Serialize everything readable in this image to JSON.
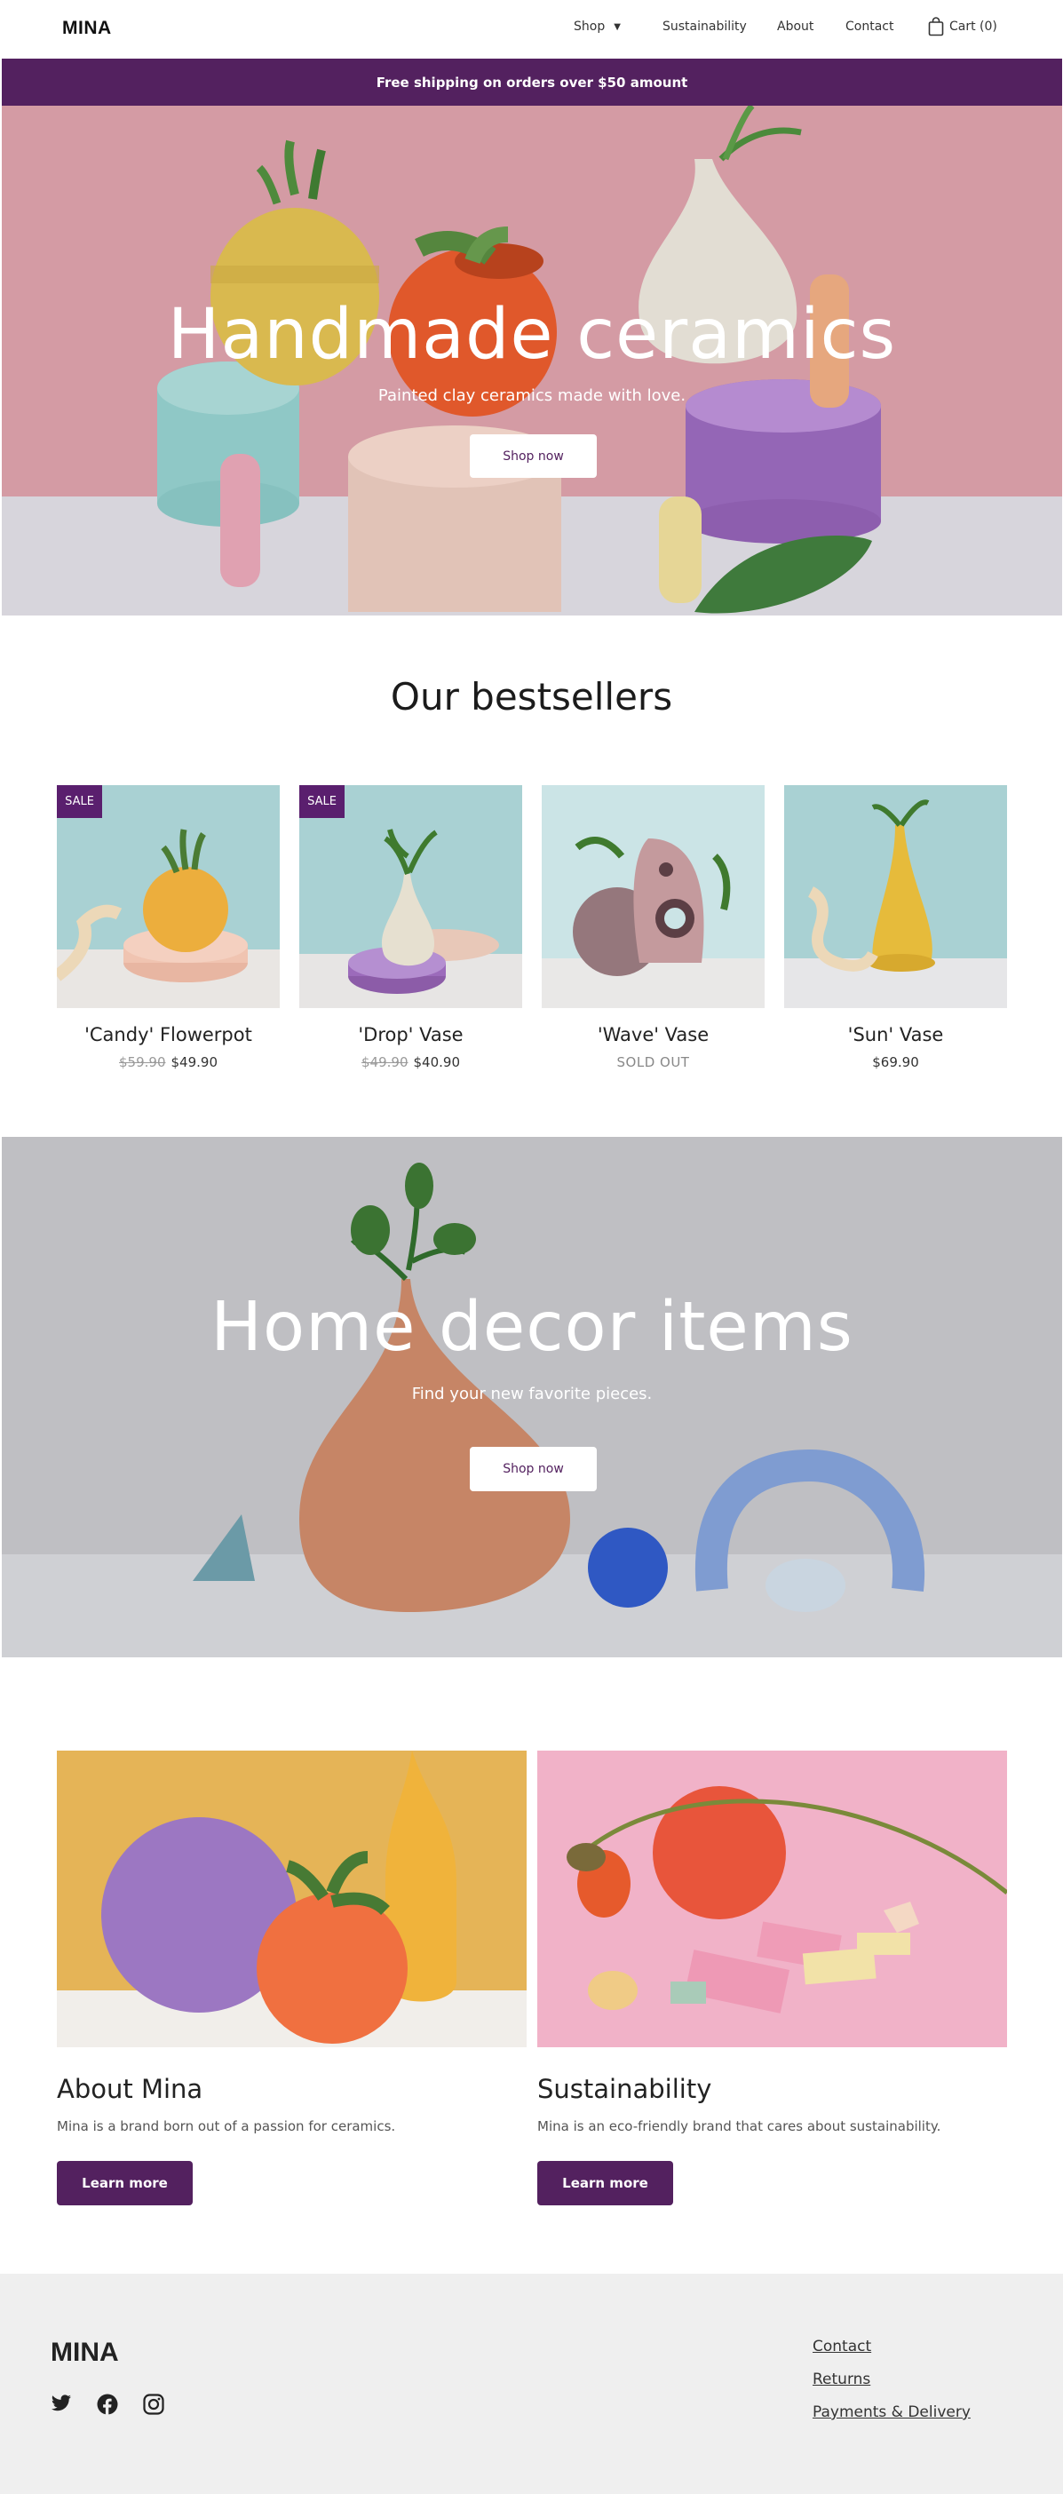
{
  "header": {
    "logo": "MINA",
    "nav": {
      "shop": "Shop",
      "sustainability": "Sustainability",
      "about": "About",
      "contact": "Contact",
      "cart": "Cart (0)"
    }
  },
  "announcement": "Free shipping on orders over $50 amount",
  "hero1": {
    "title": "Handmade ceramics",
    "subtitle": "Painted clay ceramics made with love.",
    "button": "Shop now"
  },
  "bestsellers": {
    "title": "Our bestsellers",
    "products": [
      {
        "name": "'Candy' Flowerpot",
        "badge": "SALE",
        "old_price": "$59.90",
        "price": "$49.90"
      },
      {
        "name": "'Drop' Vase",
        "badge": "SALE",
        "old_price": "$49.90",
        "price": "$40.90"
      },
      {
        "name": "'Wave' Vase",
        "status": "SOLD OUT"
      },
      {
        "name": "'Sun' Vase",
        "price": "$69.90"
      }
    ]
  },
  "hero2": {
    "title": "Home decor items",
    "subtitle": "Find your new favorite pieces.",
    "button": "Shop now"
  },
  "features": [
    {
      "title": "About Mina",
      "description": "Mina is a brand born out of a passion for ceramics.",
      "button": "Learn more"
    },
    {
      "title": "Sustainability",
      "description": "Mina is an eco-friendly brand that cares about sustainability.",
      "button": "Learn more"
    }
  ],
  "footer": {
    "logo": "MINA",
    "social": [
      "twitter-icon",
      "facebook-icon",
      "instagram-icon"
    ],
    "links": [
      "Contact",
      "Returns",
      "Payments & Delivery"
    ]
  },
  "colors": {
    "brand": "#53215f",
    "sale_badge": "#5a1f6e",
    "hero1_bg": "#d69aa3",
    "hero2_bg": "#c4c4c8",
    "footer_bg": "#efefef"
  }
}
